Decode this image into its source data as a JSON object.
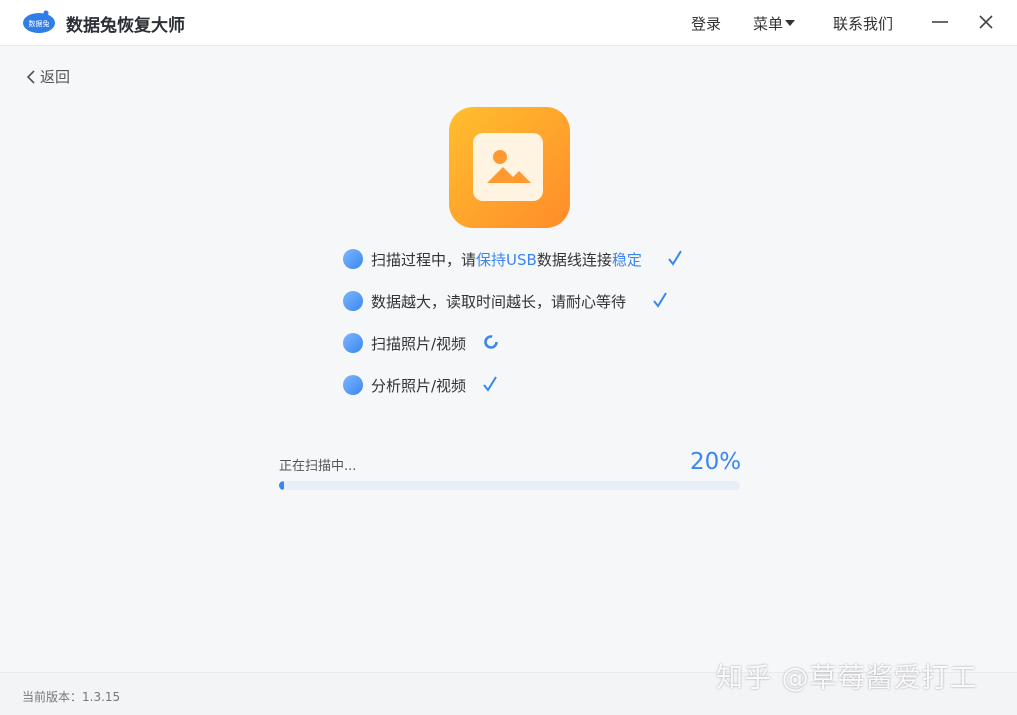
{
  "app": {
    "title": "数据兔恢复大师",
    "logo_text": "数据兔"
  },
  "titlebar": {
    "login": "登录",
    "menu": "菜单",
    "contact": "联系我们",
    "minimize_icon": "minimize-icon",
    "close_icon": "close-icon"
  },
  "nav": {
    "back_label": "返回"
  },
  "hero": {
    "icon": "photo-icon",
    "colors": {
      "from": "#ffbf2e",
      "to": "#ff8c2a"
    }
  },
  "steps": [
    {
      "icon": "usb-icon",
      "text_a": "扫描过程中，请",
      "text_hl1": "保持USB",
      "text_b": "数据线连接",
      "text_hl2": "稳定",
      "status": "done"
    },
    {
      "icon": "clock-icon",
      "text": "数据越大，读取时间越长，请耐心等待",
      "status": "done"
    },
    {
      "icon": "scan-target-icon",
      "text": "扫描照片/视频",
      "status": "in-progress"
    },
    {
      "icon": "chart-icon",
      "text": "分析照片/视频",
      "status": "done"
    }
  ],
  "scan": {
    "label": "正在扫描中...",
    "percent_text": "20%",
    "progress_fraction": 0.01
  },
  "footer": {
    "version": "当前版本：1.3.15"
  },
  "watermark": {
    "text": "知乎 @草莓酱爱打工"
  },
  "colors": {
    "accent": "#3a86f0",
    "background": "#f6f7f9"
  }
}
